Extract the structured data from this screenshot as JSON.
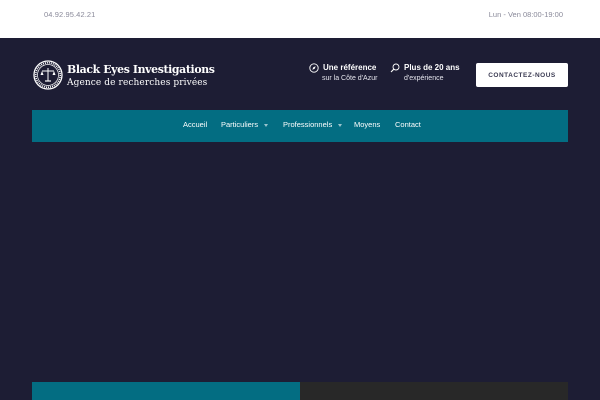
{
  "topbar": {
    "phone": "04.92.95.42.21",
    "hours": "Lun - Ven 08:00-19:00"
  },
  "brand": {
    "name": "Black Eyes Investigations",
    "tagline": "Agence de recherches privées",
    "logo_icon": "seal-scales-icon"
  },
  "highlights": [
    {
      "icon": "compass-icon",
      "title": "Une référence",
      "subtitle": "sur la Côte d'Azur"
    },
    {
      "icon": "search-icon",
      "title": "Plus de 20 ans",
      "subtitle": "d'expérience"
    }
  ],
  "cta": {
    "label": "CONTACTEZ-NOUS"
  },
  "nav": {
    "items": [
      {
        "label": "Accueil",
        "has_dropdown": false
      },
      {
        "label": "Particuliers",
        "has_dropdown": true
      },
      {
        "label": "Professionnels",
        "has_dropdown": true
      },
      {
        "label": "Moyens",
        "has_dropdown": false
      },
      {
        "label": "Contact",
        "has_dropdown": false
      }
    ]
  },
  "colors": {
    "background": "#1d1d34",
    "nav": "#036d82",
    "topbar": "#ffffff",
    "dark_panel": "#282828"
  }
}
